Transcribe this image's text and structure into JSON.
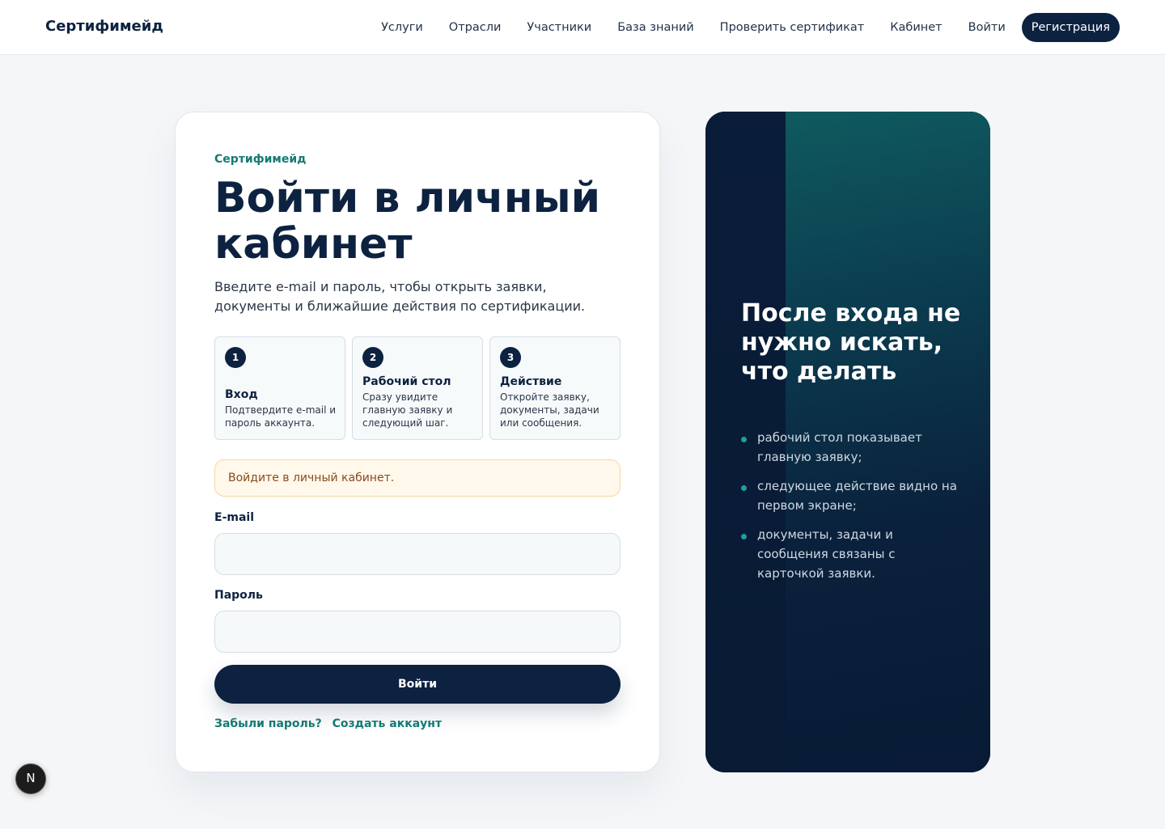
{
  "header": {
    "brand": "Сертифимейд",
    "nav": [
      {
        "label": "Услуги"
      },
      {
        "label": "Отрасли"
      },
      {
        "label": "Участники"
      },
      {
        "label": "База знаний"
      },
      {
        "label": "Проверить сертификат"
      },
      {
        "label": "Кабинет"
      },
      {
        "label": "Войти"
      }
    ],
    "register_label": "Регистрация"
  },
  "login": {
    "eyebrow": "Сертифимейд",
    "title": "Войти в личный кабинет",
    "lead": "Введите e-mail и пароль, чтобы открыть заявки, документы и ближайшие действия по сертификации.",
    "steps": [
      {
        "num": "1",
        "title": "Вход",
        "text": "Подтвердите e-mail и пароль аккаунта."
      },
      {
        "num": "2",
        "title": "Рабочий стол",
        "text": "Сразу увидите главную заявку и следующий шаг."
      },
      {
        "num": "3",
        "title": "Действие",
        "text": "Откройте заявку, документы, задачи или сообщения."
      }
    ],
    "alert": "Войдите в личный кабинет.",
    "email_label": "E-mail",
    "email_value": "",
    "password_label": "Пароль",
    "password_value": "",
    "submit_label": "Войти",
    "forgot_link": "Забыли пароль?",
    "create_link": "Создать аккаунт"
  },
  "panel": {
    "title": "После входа не нужно искать, что делать",
    "items": [
      "рабочий стол показывает главную заявку;",
      "следующее действие видно на первом экране;",
      "документы, задачи и сообщения связаны с карточкой заявки."
    ]
  },
  "badge": {
    "letter": "N",
    "icon": "nextjs-badge-icon"
  },
  "colors": {
    "navy": "#0d2240",
    "teal": "#157a74",
    "alert_bg": "#fff8eb",
    "alert_text": "#8a4b1c",
    "page_bg": "#f4f6f8"
  }
}
